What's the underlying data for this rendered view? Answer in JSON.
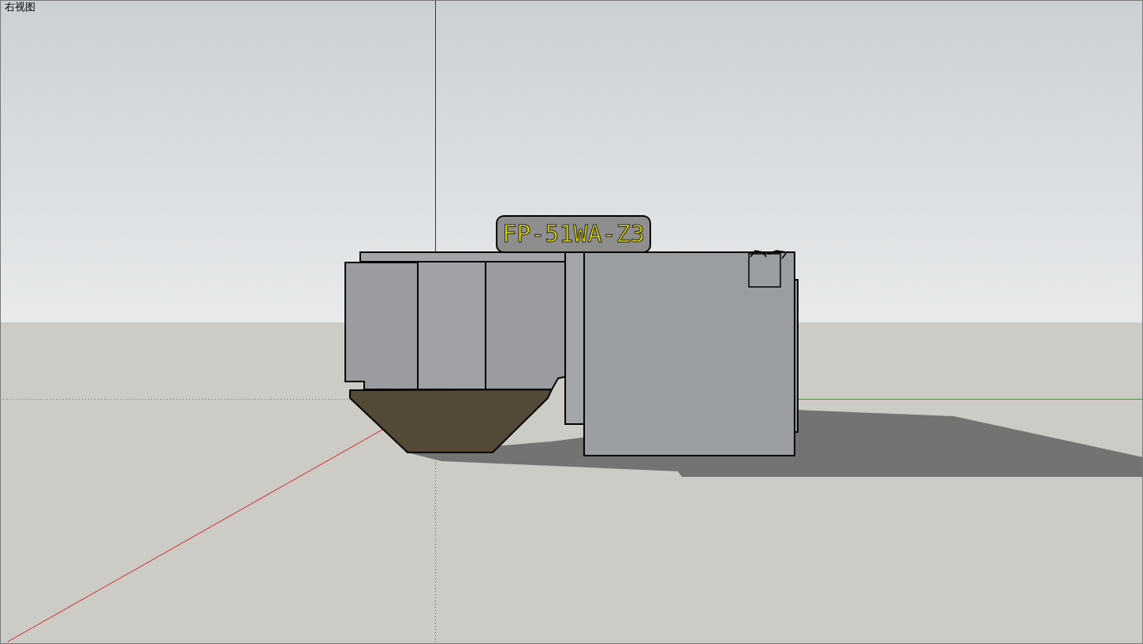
{
  "viewport": {
    "view_name": "右视图",
    "label": "FP-51WA-Z3"
  }
}
